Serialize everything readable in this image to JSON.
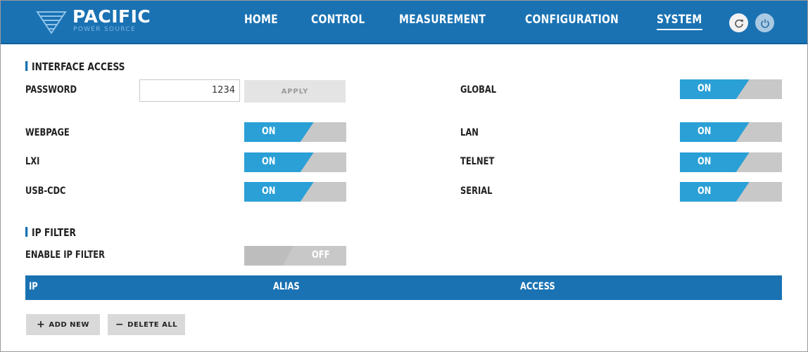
{
  "brand": {
    "name": "PACIFIC",
    "subtitle": "POWER SOURCE"
  },
  "nav": {
    "items": [
      "HOME",
      "CONTROL",
      "MEASUREMENT",
      "CONFIGURATION",
      "SYSTEM"
    ],
    "active": "SYSTEM"
  },
  "header_buttons": {
    "refresh_icon": "refresh-icon",
    "power_icon": "power-icon"
  },
  "interface_access": {
    "title": "INTERFACE ACCESS",
    "password": {
      "label": "PASSWORD",
      "value": "1234",
      "apply_label": "APPLY"
    },
    "global": {
      "label": "GLOBAL",
      "state": "ON"
    },
    "webpage": {
      "label": "WEBPAGE",
      "state": "ON"
    },
    "lan": {
      "label": "LAN",
      "state": "ON"
    },
    "lxi": {
      "label": "LXI",
      "state": "ON"
    },
    "telnet": {
      "label": "TELNET",
      "state": "ON"
    },
    "usb_cdc": {
      "label": "USB-CDC",
      "state": "ON"
    },
    "serial": {
      "label": "SERIAL",
      "state": "ON"
    }
  },
  "ip_filter": {
    "title": "IP FILTER",
    "enable": {
      "label": "ENABLE IP FILTER",
      "state": "OFF"
    },
    "columns": [
      "IP",
      "ALIAS",
      "ACCESS"
    ],
    "add_label": "ADD NEW",
    "delete_label": "DELETE ALL"
  },
  "colors": {
    "primary": "#1a72b3",
    "toggle_on": "#2aa0d6",
    "toggle_off": "#c8c8c8"
  }
}
